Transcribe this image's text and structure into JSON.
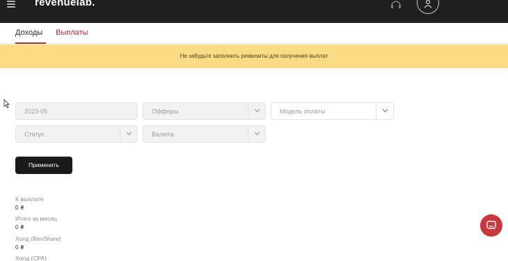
{
  "header": {
    "logo": "revenuelab.",
    "menu_icon": "hamburger-menu-icon",
    "support_icon": "headset-icon",
    "profile_icon": "user-icon"
  },
  "tabs": [
    {
      "label": "Доходы",
      "active": true
    },
    {
      "label": "Выплаты",
      "active": false
    }
  ],
  "banner": {
    "text": "Не забудьте заполнить реквизиты для получения выплат"
  },
  "filters": {
    "date": {
      "value": "2023-05"
    },
    "offers": {
      "placeholder": "Офферы"
    },
    "payment_model": {
      "placeholder": "Модель оплаты"
    },
    "status": {
      "placeholder": "Статус"
    },
    "currency": {
      "placeholder": "Валюта"
    }
  },
  "apply_button": {
    "label": "Применить"
  },
  "stats": [
    {
      "label": "К выплате",
      "value": "0 ₴"
    },
    {
      "label": "Итого за месяц",
      "value": "0 ₴"
    },
    {
      "label": "Холд (RevShare)",
      "value": "0 ₴"
    },
    {
      "label": "Холд (CPA)",
      "value": ""
    }
  ],
  "colors": {
    "accent": "#c0282b",
    "banner_bg": "#fbdb84",
    "topbar_bg": "#1f1f1f",
    "button_bg": "#1a1a1a",
    "chat_bg": "#c9383d"
  },
  "chat": {
    "icon": "chat-bubble-icon"
  }
}
